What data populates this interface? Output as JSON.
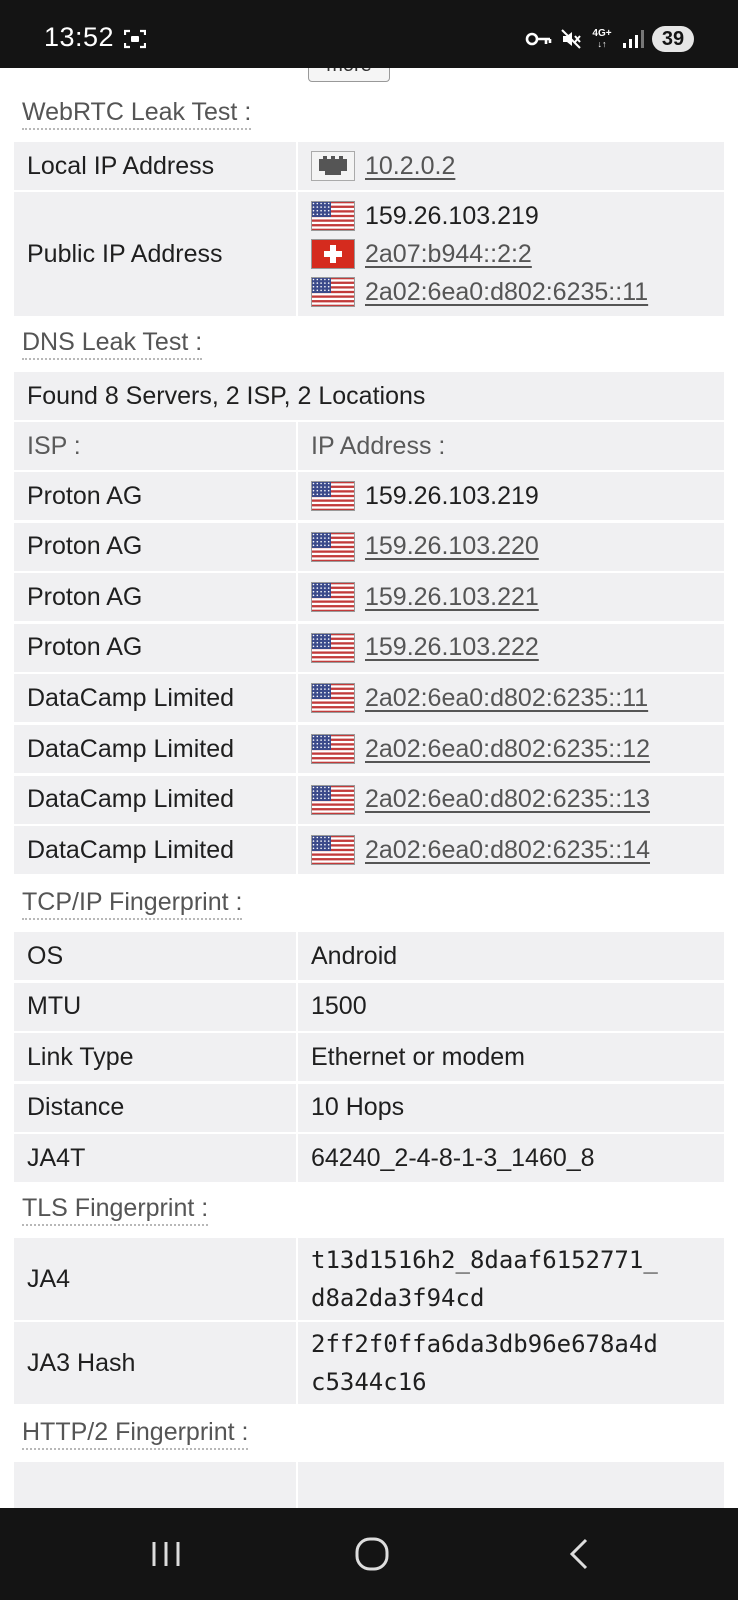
{
  "status_bar": {
    "time": "13:52",
    "network": "4G+",
    "battery": "39",
    "icons": [
      "screen-recorder-icon",
      "vpn-key-icon",
      "mute-icon",
      "signal-icon"
    ]
  },
  "more_button": "more",
  "webrtc": {
    "title": "WebRTC Leak Test :",
    "local_label": "Local IP Address",
    "local_ip": "10.2.0.2",
    "public_label": "Public IP Address",
    "public_ips": [
      {
        "flag": "us",
        "ip": "159.26.103.219",
        "link": false
      },
      {
        "flag": "ch",
        "ip": "2a07:b944::2:2",
        "link": true
      },
      {
        "flag": "us",
        "ip": "2a02:6ea0:d802:6235::11",
        "link": true
      }
    ]
  },
  "dns": {
    "title": "DNS Leak Test :",
    "summary": "Found 8 Servers, 2 ISP, 2 Locations",
    "isp_header": "ISP :",
    "ip_header": "IP Address :",
    "rows": [
      {
        "isp": "Proton AG",
        "ip": "159.26.103.219",
        "link": false
      },
      {
        "isp": "Proton AG",
        "ip": "159.26.103.220",
        "link": true
      },
      {
        "isp": "Proton AG",
        "ip": "159.26.103.221",
        "link": true
      },
      {
        "isp": "Proton AG",
        "ip": "159.26.103.222",
        "link": true
      },
      {
        "isp": "DataCamp Limited",
        "ip": "2a02:6ea0:d802:6235::11",
        "link": true
      },
      {
        "isp": "DataCamp Limited",
        "ip": "2a02:6ea0:d802:6235::12",
        "link": true
      },
      {
        "isp": "DataCamp Limited",
        "ip": "2a02:6ea0:d802:6235::13",
        "link": true
      },
      {
        "isp": "DataCamp Limited",
        "ip": "2a02:6ea0:d802:6235::14",
        "link": true
      }
    ]
  },
  "tcp": {
    "title": "TCP/IP Fingerprint :",
    "rows": [
      {
        "label": "OS",
        "value": "Android"
      },
      {
        "label": "MTU",
        "value": "1500"
      },
      {
        "label": "Link Type",
        "value": "Ethernet or modem"
      },
      {
        "label": "Distance",
        "value": "10 Hops"
      },
      {
        "label": "JA4T",
        "value": "64240_2-4-8-1-3_1460_8"
      }
    ]
  },
  "tls": {
    "title": "TLS Fingerprint :",
    "rows": [
      {
        "label": "JA4",
        "line1": "t13d1516h2_8daaf6152771_",
        "line2": "d8a2da3f94cd"
      },
      {
        "label": "JA3 Hash",
        "line1": "2ff2f0ffa6da3db96e678a4d",
        "line2": "c5344c16"
      }
    ]
  },
  "http2": {
    "title": "HTTP/2 Fingerprint :"
  },
  "colors": {
    "row_bg": "#f0f0f2",
    "status_bg": "#141414",
    "link": "#555555"
  }
}
